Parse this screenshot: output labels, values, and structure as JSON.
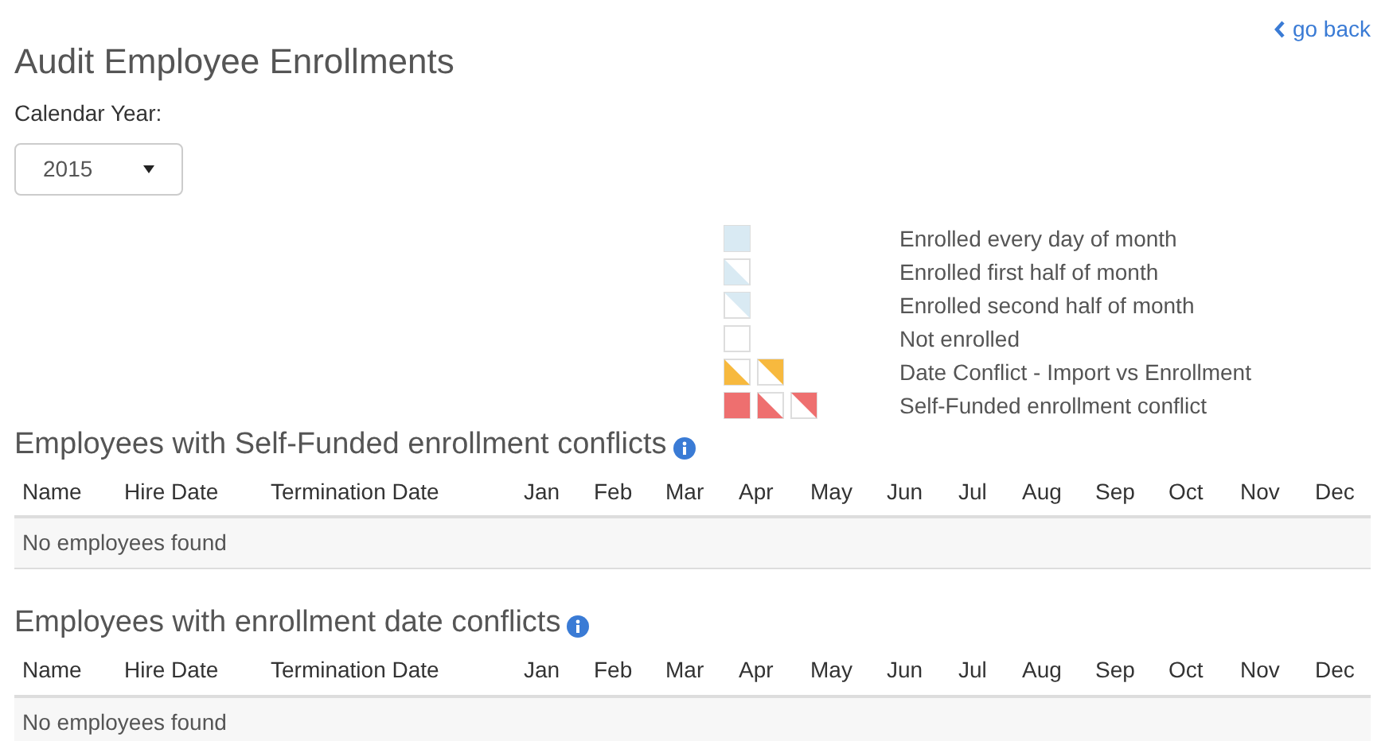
{
  "back_link": {
    "label": "go back"
  },
  "title": "Audit Employee Enrollments",
  "year_select": {
    "label": "Calendar Year:",
    "value": "2015"
  },
  "legend": [
    {
      "label": "Enrolled every day of month",
      "swatches": [
        {
          "kind": "full",
          "color": "#d9eaf3"
        }
      ]
    },
    {
      "label": "Enrolled first half of month",
      "swatches": [
        {
          "kind": "lower",
          "color": "#d9eaf3"
        }
      ]
    },
    {
      "label": "Enrolled second half of month",
      "swatches": [
        {
          "kind": "upper",
          "color": "#d9eaf3"
        }
      ]
    },
    {
      "label": "Not enrolled",
      "swatches": [
        {
          "kind": "empty"
        }
      ]
    },
    {
      "label": "Date Conflict - Import vs Enrollment",
      "swatches": [
        {
          "kind": "lower",
          "color": "#f7b93e"
        },
        {
          "kind": "upper",
          "color": "#f7b93e"
        }
      ]
    },
    {
      "label": "Self-Funded enrollment conflict",
      "swatches": [
        {
          "kind": "full",
          "color": "#ee6f6f"
        },
        {
          "kind": "lower",
          "color": "#ee6f6f"
        },
        {
          "kind": "upper",
          "color": "#ee6f6f"
        }
      ]
    }
  ],
  "tables": [
    {
      "title": "Employees with Self-Funded enrollment conflicts",
      "columns": [
        "Name",
        "Hire Date",
        "Termination Date",
        "Jan",
        "Feb",
        "Mar",
        "Apr",
        "May",
        "Jun",
        "Jul",
        "Aug",
        "Sep",
        "Oct",
        "Nov",
        "Dec"
      ],
      "empty_message": "No employees found"
    },
    {
      "title": "Employees with enrollment date conflicts",
      "columns": [
        "Name",
        "Hire Date",
        "Termination Date",
        "Jan",
        "Feb",
        "Mar",
        "Apr",
        "May",
        "Jun",
        "Jul",
        "Aug",
        "Sep",
        "Oct",
        "Nov",
        "Dec"
      ],
      "empty_message": "No employees found"
    }
  ]
}
